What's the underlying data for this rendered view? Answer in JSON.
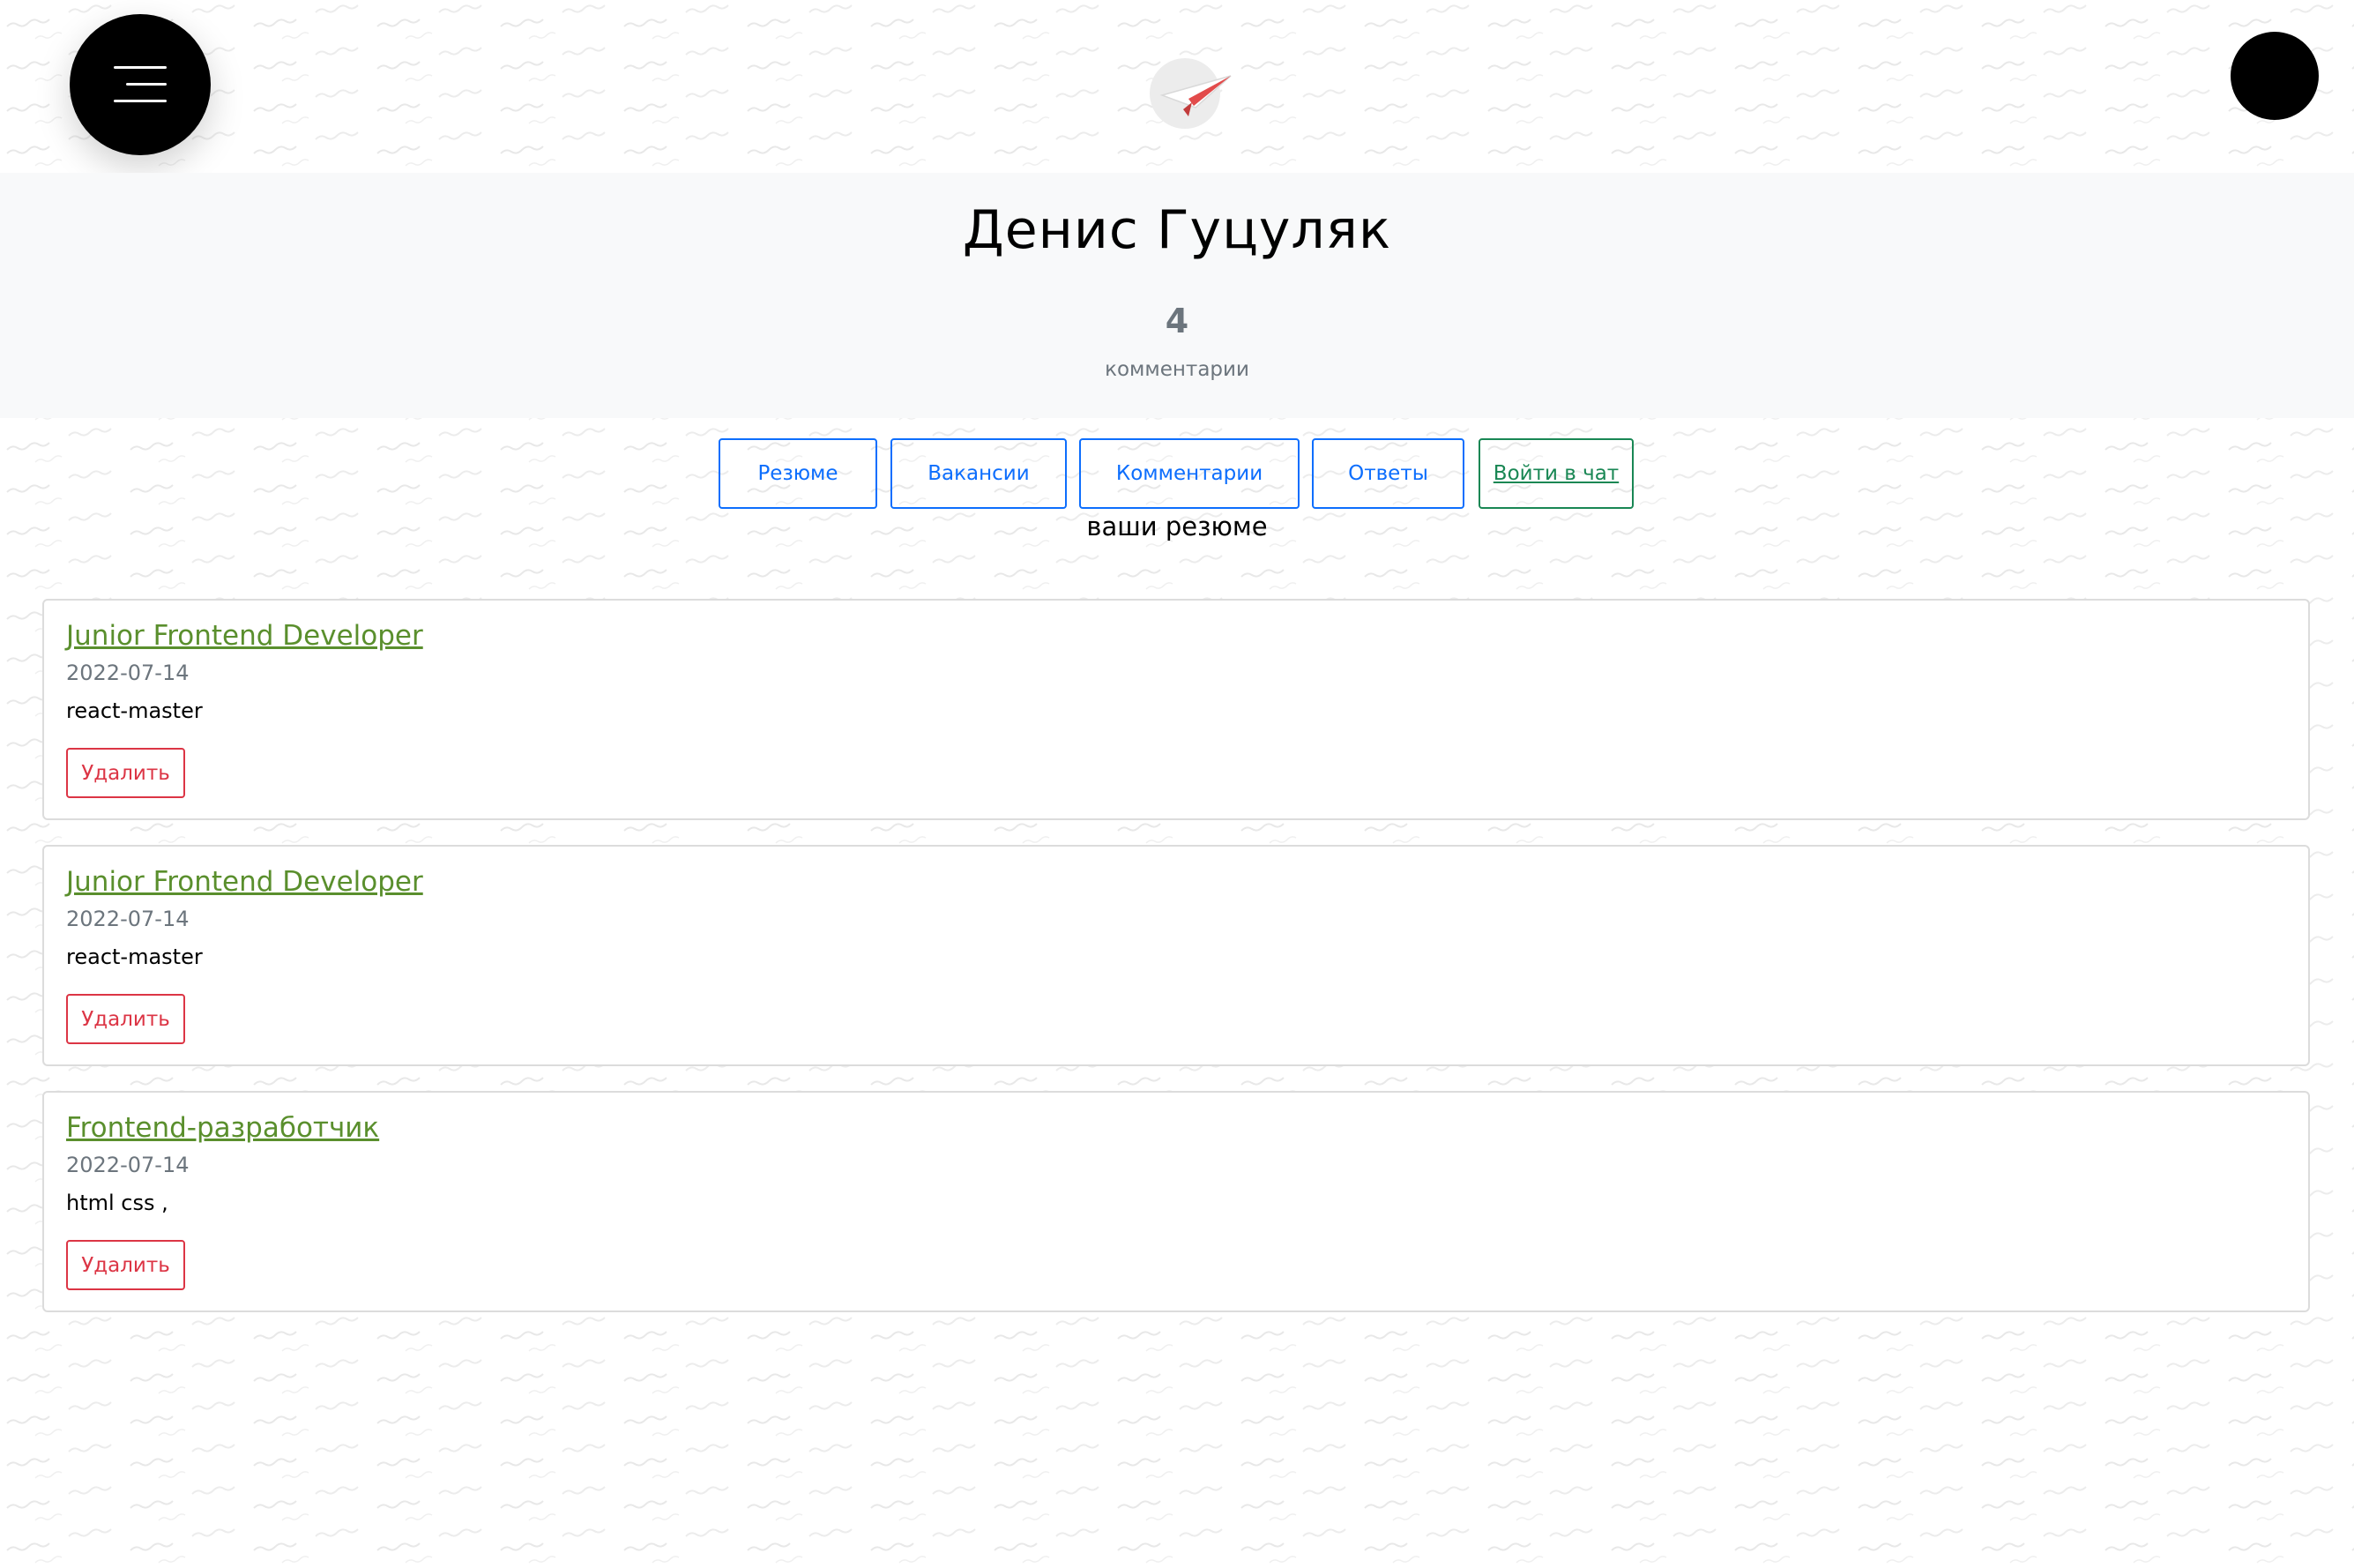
{
  "header": {
    "menu_icon": "hamburger-menu-icon",
    "logo_icon": "paper-plane-logo-icon",
    "avatar_icon": "user-avatar"
  },
  "profile": {
    "name": "Денис Гуцуляк",
    "comments_count": "4",
    "comments_label": "комментарии"
  },
  "tabs": [
    {
      "label": "Резюме"
    },
    {
      "label": "Вакансии"
    },
    {
      "label": "Комментарии"
    },
    {
      "label": "Ответы"
    },
    {
      "label": "Войти в чат"
    }
  ],
  "section_title": "ваши резюме",
  "resumes": [
    {
      "title": "Junior Frontend Developer",
      "date": "2022-07-14",
      "description": "react-master",
      "delete_label": "Удалить"
    },
    {
      "title": "Junior Frontend Developer",
      "date": "2022-07-14",
      "description": "react-master",
      "delete_label": "Удалить"
    },
    {
      "title": "Frontend-разработчик",
      "date": "2022-07-14",
      "description": "html css ,",
      "delete_label": "Удалить"
    }
  ],
  "colors": {
    "primary": "#0d6efd",
    "success": "#198754",
    "danger": "#dc3545",
    "link_green": "#5a8f2d",
    "muted": "#6c757d",
    "band": "#f8f9fa"
  }
}
